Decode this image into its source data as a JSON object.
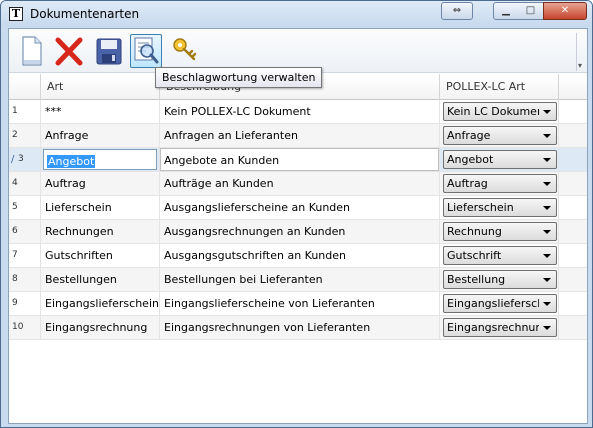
{
  "window": {
    "title": "Dokumentenarten",
    "app_icon_letter": "T",
    "restore_alt_glyph": "⇔",
    "minimize_glyph": "▁",
    "maximize_glyph": "□",
    "close_glyph": "✕"
  },
  "toolbar": {
    "buttons": [
      {
        "name": "new-document",
        "icon": "document-icon"
      },
      {
        "name": "delete",
        "icon": "red-x-icon"
      },
      {
        "name": "save",
        "icon": "floppy-disk-icon"
      },
      {
        "name": "keywording",
        "icon": "magnifier-document-icon",
        "active": true
      },
      {
        "name": "key",
        "icon": "key-icon"
      }
    ],
    "tooltip": "Beschlagwortung verwalten",
    "overflow_glyph": "▾"
  },
  "grid": {
    "headers": [
      "Art",
      "Beschreibung",
      "POLLEX-LC Art"
    ],
    "current_row_marker": "/",
    "rows": [
      {
        "num": "1",
        "art": "***",
        "desc": "Kein POLLEX-LC Dokument",
        "pollex": "Kein LC Dokument"
      },
      {
        "num": "2",
        "art": "Anfrage",
        "desc": "Anfragen an Lieferanten",
        "pollex": "Anfrage"
      },
      {
        "num": "3",
        "art": "Angebot",
        "desc": "Angebote an Kunden",
        "pollex": "Angebot"
      },
      {
        "num": "4",
        "art": "Auftrag",
        "desc": "Aufträge an Kunden",
        "pollex": "Auftrag"
      },
      {
        "num": "5",
        "art": "Lieferschein",
        "desc": "Ausgangslieferscheine an Kunden",
        "pollex": "Lieferschein"
      },
      {
        "num": "6",
        "art": "Rechnungen",
        "desc": "Ausgangsrechnungen an Kunden",
        "pollex": "Rechnung"
      },
      {
        "num": "7",
        "art": "Gutschriften",
        "desc": "Ausgangsgutschriften an Kunden",
        "pollex": "Gutschrift"
      },
      {
        "num": "8",
        "art": "Bestellungen",
        "desc": "Bestellungen bei Lieferanten",
        "pollex": "Bestellung"
      },
      {
        "num": "9",
        "art": "Eingangslieferschein",
        "desc": "Eingangslieferscheine von Lieferanten",
        "pollex": "Eingangslieferschein"
      },
      {
        "num": "10",
        "art": "Eingangsrechnung",
        "desc": "Eingangsrechnungen von Lieferanten",
        "pollex": "Eingangsrechnung"
      }
    ]
  },
  "colors": {
    "selection": "#3399ff",
    "current_row": "#ddeaf6",
    "close_button": "#c4452c"
  }
}
